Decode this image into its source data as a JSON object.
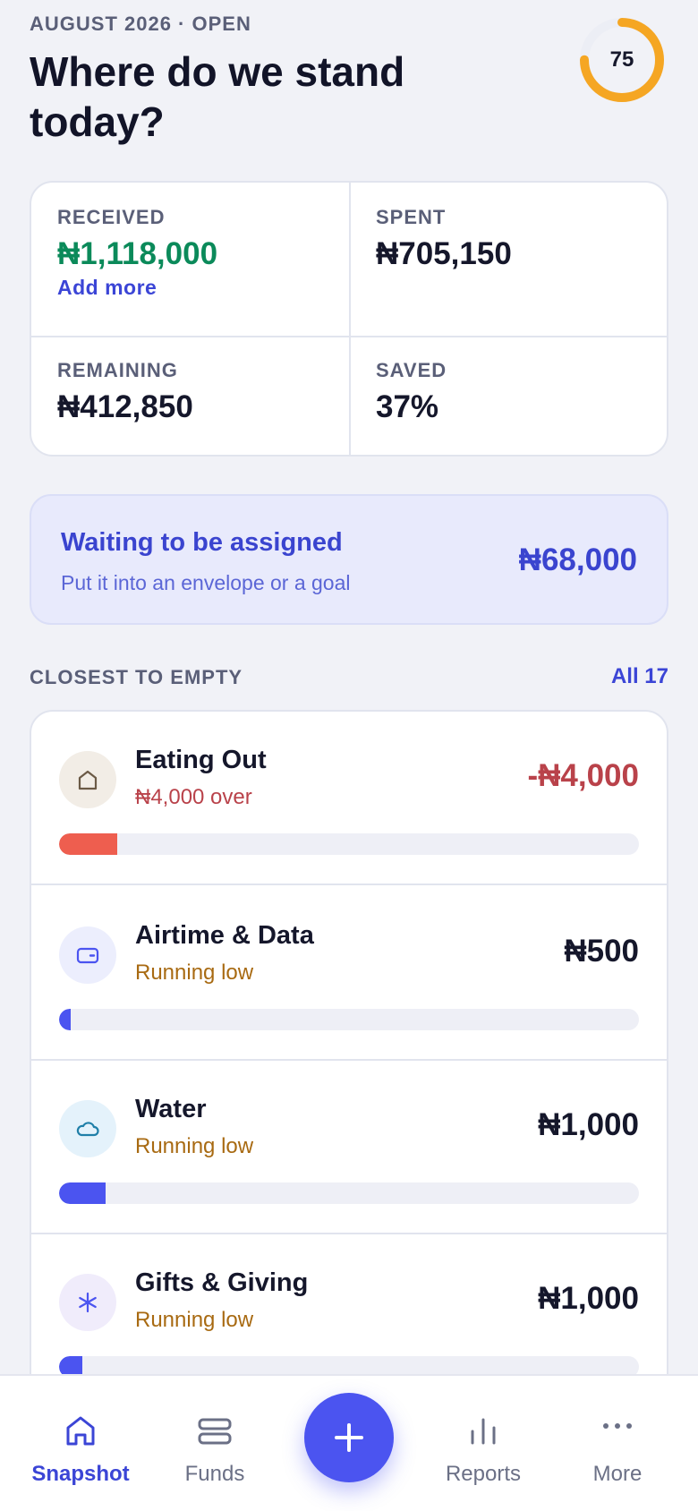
{
  "header": {
    "period": "AUGUST 2026 · OPEN",
    "title_line1": "Where do we stand",
    "title_line2": "today?",
    "score": "75",
    "score_fraction": 0.75,
    "score_color": "#f5a623"
  },
  "stats": {
    "received": {
      "label": "RECEIVED",
      "value": "₦1,118,000",
      "link": "Add more"
    },
    "spent": {
      "label": "SPENT",
      "value": "₦705,150"
    },
    "remaining": {
      "label": "REMAINING",
      "value": "₦412,850"
    },
    "saved": {
      "label": "SAVED",
      "value": "37%"
    }
  },
  "waiting": {
    "title": "Waiting to be assigned",
    "subtitle": "Put it into an envelope or a goal",
    "amount": "₦68,000"
  },
  "section": {
    "title": "CLOSEST TO EMPTY",
    "link": "All 17"
  },
  "envelopes": [
    {
      "name": "Eating Out",
      "status": "₦4,000 over",
      "amount": "-₦4,000",
      "icon": "house-icon",
      "fill": 0.1,
      "status_color": "#b9424a",
      "amount_color": "#b9424a",
      "bar_color": "#ee5e4f",
      "icon_bg": "#f2ede6"
    },
    {
      "name": "Airtime & Data",
      "status": "Running low",
      "amount": "₦500",
      "icon": "wallet-icon",
      "fill": 0.02,
      "status_color": "#a86a12",
      "amount_color": "#15172b",
      "bar_color": "#4b54f0",
      "icon_bg": "#eceefd"
    },
    {
      "name": "Water",
      "status": "Running low",
      "amount": "₦1,000",
      "icon": "cloud-icon",
      "fill": 0.08,
      "status_color": "#a86a12",
      "amount_color": "#15172b",
      "bar_color": "#4b54f0",
      "icon_bg": "#e4f2fb"
    },
    {
      "name": "Gifts & Giving",
      "status": "Running low",
      "amount": "₦1,000",
      "icon": "asterisk-icon",
      "fill": 0.04,
      "status_color": "#a86a12",
      "amount_color": "#15172b",
      "bar_color": "#4b54f0",
      "icon_bg": "#f0ecfb"
    }
  ],
  "nav": {
    "snapshot": "Snapshot",
    "funds": "Funds",
    "add": "+",
    "reports": "Reports",
    "more": "More"
  },
  "colors": {
    "accent": "#4b54f0",
    "positive": "#0b8a5a",
    "negative": "#b9424a",
    "warning": "#a86a12"
  }
}
